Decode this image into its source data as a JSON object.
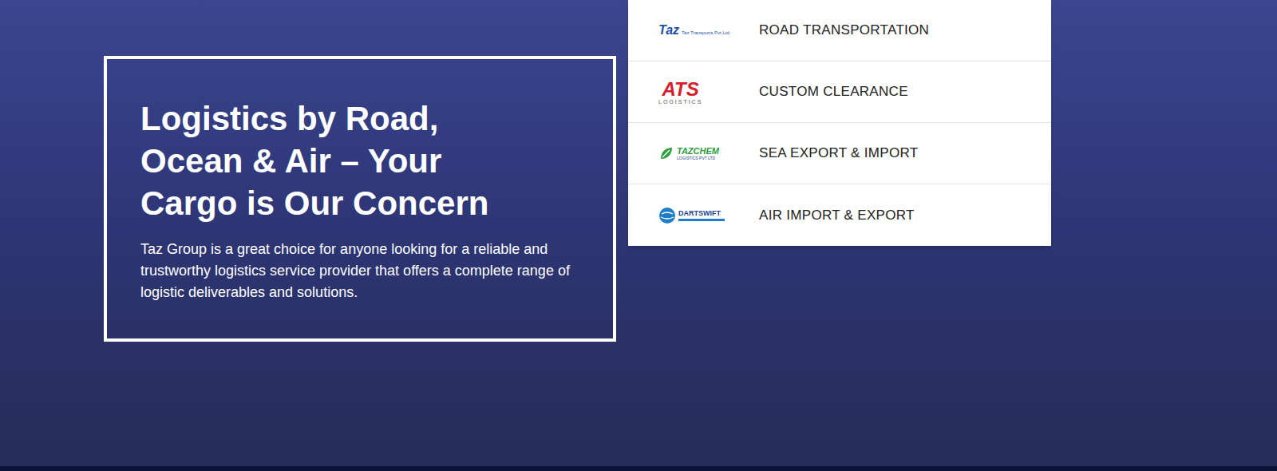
{
  "hero": {
    "title": "Logistics by Road, Ocean & Air – Your Cargo is Our Concern",
    "description": "Taz Group is a great choice for anyone looking for a reliable and trustworthy logistics service provider that offers a complete range of logistic deliverables and solutions."
  },
  "services": [
    {
      "label": "ROAD TRANSPORTATION",
      "kind": "taz",
      "logo": {
        "mark": "Taz",
        "text": "Taz Transports Pvt Ltd"
      }
    },
    {
      "label": "CUSTOM CLEARANCE",
      "kind": "ats",
      "logo": {
        "mark": "ATS",
        "text": "LOGISTICS"
      }
    },
    {
      "label": "SEA EXPORT & IMPORT",
      "kind": "tazchem",
      "logo": {
        "mark": "TAZCHEM",
        "text": "LOGISTICS PVT LTD"
      }
    },
    {
      "label": "AIR IMPORT & EXPORT",
      "kind": "dartswift",
      "logo": {
        "mark": "DARTSWIFT",
        "text": ""
      }
    }
  ]
}
